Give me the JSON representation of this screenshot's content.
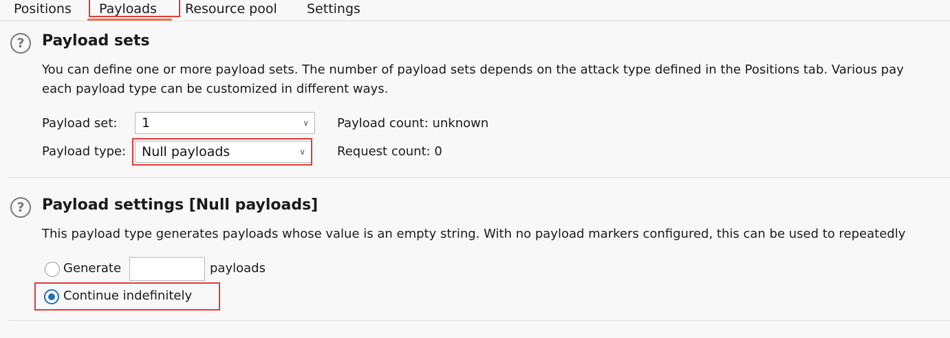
{
  "tabs": [
    {
      "label": "Positions"
    },
    {
      "label": "Payloads"
    },
    {
      "label": "Resource pool"
    },
    {
      "label": "Settings"
    }
  ],
  "active_tab": "Payloads",
  "icons": {
    "help": "help-circle-icon",
    "dropdown": "chevron-down-icon"
  },
  "colors": {
    "highlight": "#e03a3a",
    "tab_underline": "#e8724a",
    "radio_selected": "#1f6fb8"
  },
  "payload_sets": {
    "title": "Payload sets",
    "description_line1": "You can define one or more payload sets. The number of payload sets depends on the attack type defined in the Positions tab. Various pay",
    "description_line2": "each payload type can be customized in different ways.",
    "set_label": "Payload set:",
    "set_value": "1",
    "type_label": "Payload type:",
    "type_value": "Null payloads",
    "payload_count": "Payload count: unknown",
    "request_count": "Request count: 0"
  },
  "payload_settings": {
    "title": "Payload settings [Null payloads]",
    "description": "This payload type generates payloads whose value is an empty string. With no payload markers configured, this can be used to repeatedly",
    "generate_label": "Generate",
    "generate_value": "",
    "payloads_suffix": "payloads",
    "continue_label": "Continue indefinitely",
    "selected_option": "Continue indefinitely"
  }
}
